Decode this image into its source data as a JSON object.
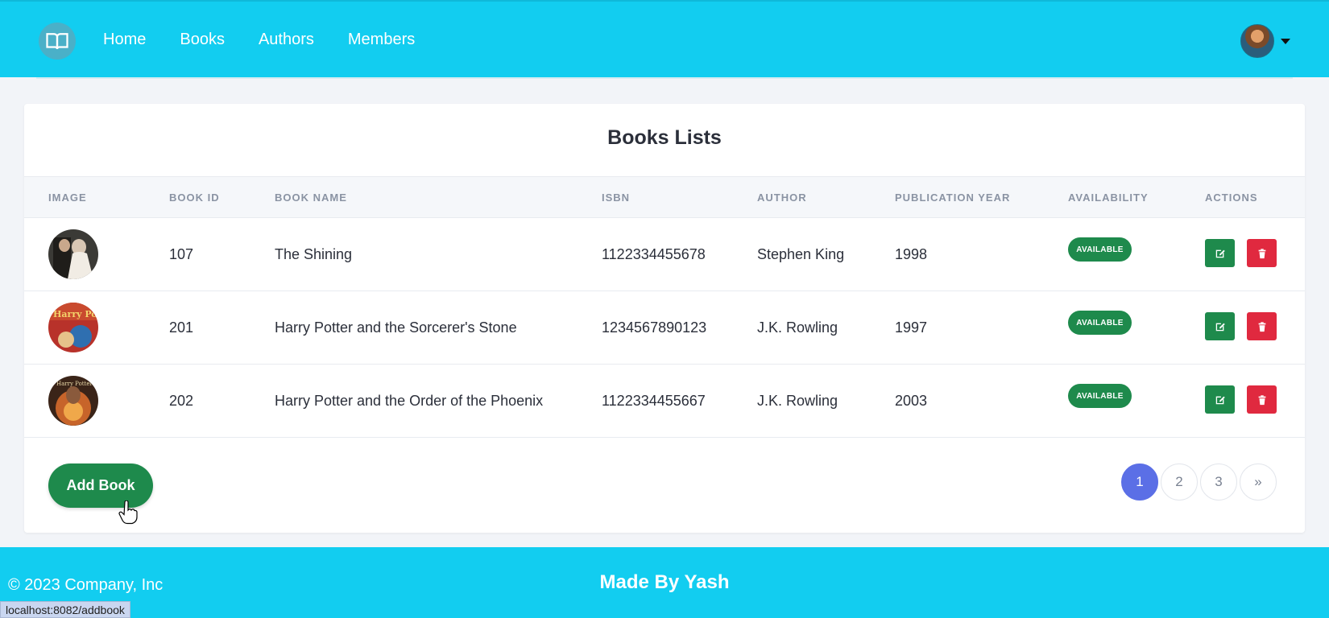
{
  "nav": {
    "links": [
      "Home",
      "Books",
      "Authors",
      "Members"
    ]
  },
  "card": {
    "title": "Books Lists",
    "columns": [
      "IMAGE",
      "BOOK ID",
      "BOOK NAME",
      "ISBN",
      "AUTHOR",
      "PUBLICATION YEAR",
      "AVAILABILITY",
      "ACTIONS"
    ],
    "rows": [
      {
        "id": "107",
        "name": "The Shining",
        "isbn": "1122334455678",
        "author": "Stephen King",
        "year": "1998",
        "availability": "AVAILABLE"
      },
      {
        "id": "201",
        "name": "Harry Potter and the Sorcerer's Stone",
        "isbn": "1234567890123",
        "author": "J.K. Rowling",
        "year": "1997",
        "availability": "AVAILABLE"
      },
      {
        "id": "202",
        "name": "Harry Potter and the Order of the Phoenix",
        "isbn": "1122334455667",
        "author": "J.K. Rowling",
        "year": "2003",
        "availability": "AVAILABLE"
      }
    ],
    "add_button": "Add Book",
    "pages": [
      "1",
      "2",
      "3",
      "»"
    ]
  },
  "footer": {
    "copyright": "© 2023 Company, Inc",
    "made_by": "Made By Yash"
  },
  "status_url": "localhost:8082/addbook",
  "colors": {
    "navbar": "#12cdf0",
    "success": "#1e8a4c",
    "danger": "#e0293f",
    "page_active": "#5b6fe6"
  }
}
